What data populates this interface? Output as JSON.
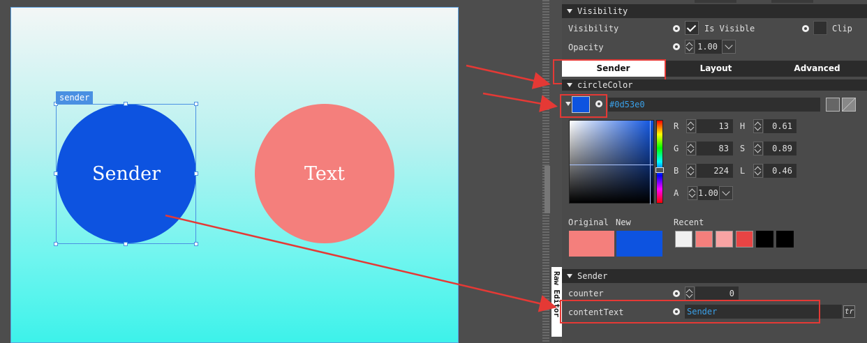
{
  "canvas": {
    "selection_tag": "sender",
    "sender_circle_text": "Sender",
    "text_circle_text": "Text"
  },
  "side_tab": {
    "label": "Raw Editor"
  },
  "visibility_section": {
    "title": "Visibility",
    "visibility_label": "Visibility",
    "is_visible_label": "Is Visible",
    "clip_label": "Clip",
    "opacity_label": "Opacity",
    "opacity_value": "1.00"
  },
  "tabs": [
    {
      "label": "Sender",
      "active": true
    },
    {
      "label": "Layout",
      "active": false
    },
    {
      "label": "Advanced",
      "active": false
    }
  ],
  "circle_color_section": {
    "title": "circleColor",
    "hex_value": "#0d53e0",
    "r_label": "R",
    "r_value": "13",
    "g_label": "G",
    "g_value": "83",
    "b_label": "B",
    "b_value": "224",
    "a_label": "A",
    "a_value": "1.00",
    "h_label": "H",
    "h_value": "0.61",
    "s_label": "S",
    "s_value": "0.89",
    "l_label": "L",
    "l_value": "0.46",
    "original_label": "Original",
    "new_label": "New",
    "recent_label": "Recent",
    "original_color": "#f47f7c",
    "new_color": "#0d53e0",
    "recent_colors": [
      "#f0f0f0",
      "#f47f7c",
      "#f8a3a3",
      "#e84444",
      "#000000",
      "#000000"
    ]
  },
  "sender_section": {
    "title": "Sender",
    "counter_label": "counter",
    "counter_value": "0",
    "content_text_label": "contentText",
    "content_text_value": "Sender",
    "tr_button": "tr"
  }
}
